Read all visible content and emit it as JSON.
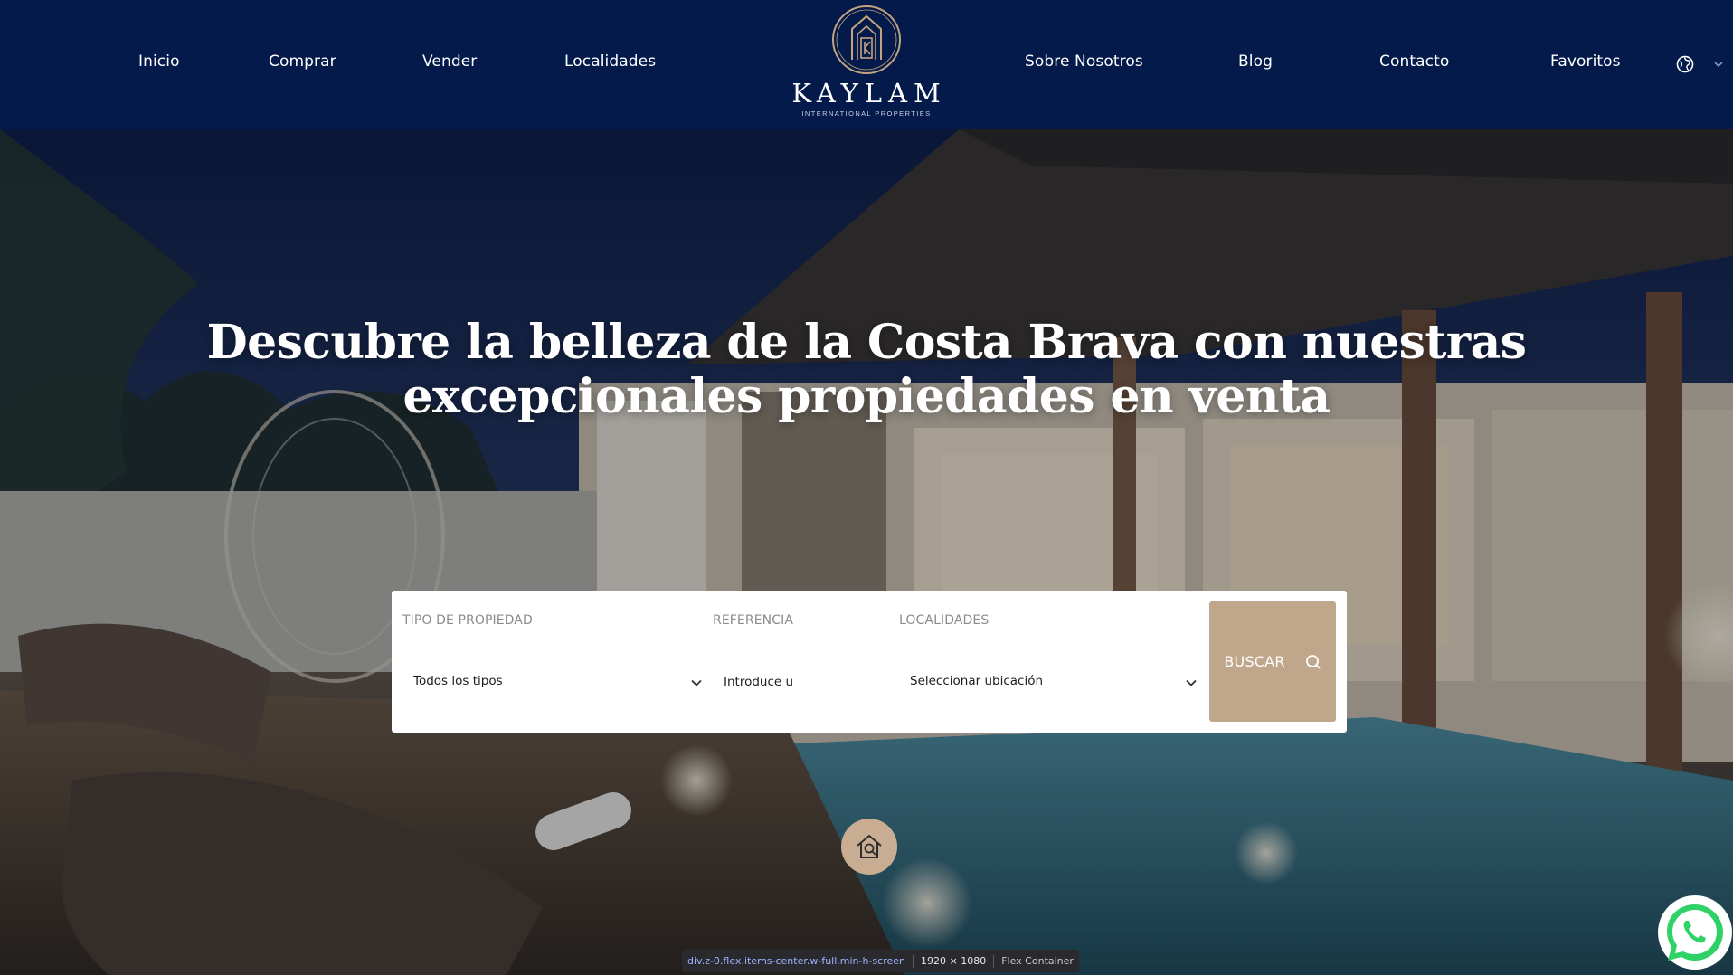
{
  "nav": {
    "left": [
      "Inicio",
      "Comprar",
      "Vender",
      "Localidades"
    ],
    "right": [
      "Sobre Nosotros",
      "Blog",
      "Contacto",
      "Favoritos"
    ],
    "language_icon": "globe-icon",
    "language_chevron": "chevron-down-icon"
  },
  "logo": {
    "name": "KAYLAM",
    "tagline": "INTERNATIONAL PROPERTIES"
  },
  "hero": {
    "title": "Descubre la belleza de la Costa Brava con nuestras excepcionales propiedades en venta"
  },
  "search": {
    "property_type": {
      "label": "TIPO DE PROPIEDAD",
      "value": "Todos los tipos"
    },
    "reference": {
      "label": "REFERENCIA",
      "placeholder": "Introduce u"
    },
    "locations": {
      "label": "LOCALIDADES",
      "value": "Seleccionar ubicación"
    },
    "button_label": "BUSCAR",
    "button_icon": "search-icon"
  },
  "devtools": {
    "selector": "div.z-0.flex.items-center.w-full.min-h-screen",
    "dimensions": "1920 × 1080",
    "kind": "Flex Container"
  },
  "colors": {
    "header_bg": "#031a4a",
    "accent": "#c0a78c",
    "text_light": "#ffffff"
  },
  "icons": {
    "home_button": "home-search-icon",
    "whatsapp": "whatsapp-icon"
  }
}
